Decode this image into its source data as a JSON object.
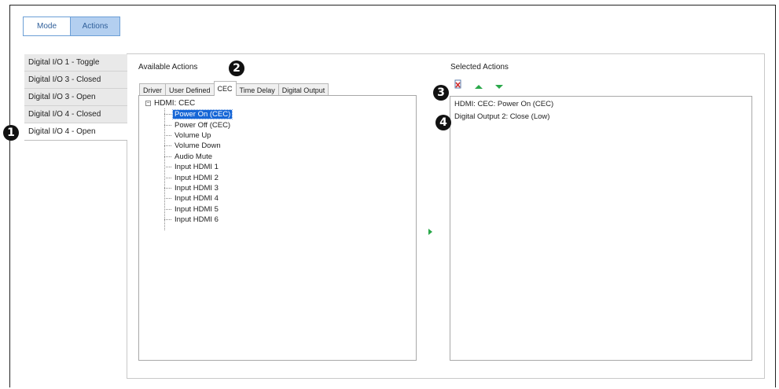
{
  "mode_bar": {
    "mode_label": "Mode",
    "actions_label": "Actions"
  },
  "io_list": [
    "Digital I/O 1 - Toggle",
    "Digital I/O 3 - Closed",
    "Digital I/O 3 - Open",
    "Digital I/O 4 - Closed",
    "Digital I/O 4 - Open"
  ],
  "available_actions_label": "Available Actions",
  "selected_actions_label": "Selected Actions",
  "tabs": [
    "Driver",
    "User Defined",
    "CEC",
    "Time Delay",
    "Digital Output"
  ],
  "active_tab": "CEC",
  "tree": {
    "root": "HDMI: CEC",
    "expander": "−",
    "items": [
      "Power On (CEC)",
      "Power Off (CEC)",
      "Volume Up",
      "Volume Down",
      "Audio Mute",
      "Input HDMI 1",
      "Input HDMI 2",
      "Input HDMI 3",
      "Input HDMI 4",
      "Input HDMI 5",
      "Input HDMI 6"
    ],
    "selected_item": "Power On (CEC)"
  },
  "selected_actions": [
    "HDMI: CEC: Power On (CEC)",
    "Digital Output 2: Close (Low)"
  ],
  "callouts": [
    "1",
    "2",
    "3",
    "4"
  ],
  "icons": {
    "delete": "delete-icon",
    "move_up": "arrow-up-icon",
    "move_down": "arrow-down-icon",
    "add": "arrow-right-icon"
  },
  "colors": {
    "accent_blue": "#b3cff0",
    "selection_blue": "#1666d6",
    "arrow_green": "#2aa84a"
  }
}
